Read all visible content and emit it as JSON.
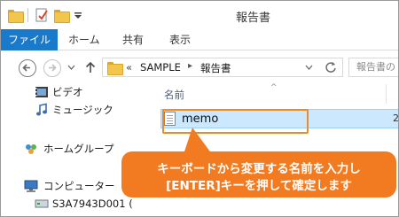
{
  "window": {
    "title": "報告書"
  },
  "ribbon": {
    "tabs": [
      {
        "label": "ファイル",
        "active": true
      },
      {
        "label": "ホーム"
      },
      {
        "label": "共有"
      },
      {
        "label": "表示"
      }
    ]
  },
  "address": {
    "overflow": "«",
    "path": [
      "SAMPLE",
      "報告書"
    ],
    "search_placeholder": "報告書の"
  },
  "navpane": {
    "items": [
      {
        "label": "ビデオ",
        "icon": "video-icon"
      },
      {
        "label": "ミュージック",
        "icon": "music-icon"
      },
      {
        "label": "ホームグループ",
        "icon": "homegroup-icon"
      },
      {
        "label": "コンピューター",
        "icon": "computer-icon"
      },
      {
        "label": "S3A7943D001 (",
        "icon": "drive-icon"
      }
    ]
  },
  "filelist": {
    "column_name": "名前",
    "column2_fragment": "2",
    "files": [
      {
        "name": "memo",
        "selected": true,
        "renaming": true
      }
    ]
  },
  "callout": {
    "line1": "キーボードから変更する名前を入力し",
    "line2": "[ENTER]キーを押して確定します"
  },
  "colors": {
    "accent": "#1979ca",
    "callout": "#f27b21",
    "selection": "#cce8ff"
  }
}
